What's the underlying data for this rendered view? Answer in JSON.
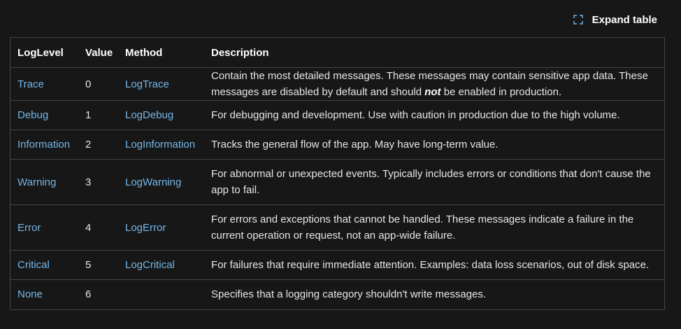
{
  "expand_label": "Expand table",
  "colors": {
    "link": "#75b6e7",
    "border": "#454545",
    "background": "#171717"
  },
  "table": {
    "headers": [
      "LogLevel",
      "Value",
      "Method",
      "Description"
    ],
    "rows": [
      {
        "level": "Trace",
        "value": "0",
        "method": "LogTrace",
        "desc_before": "Contain the most detailed messages. These messages may contain sensitive app data. These messages are disabled by default and should ",
        "desc_em": "not",
        "desc_after": " be enabled in production."
      },
      {
        "level": "Debug",
        "value": "1",
        "method": "LogDebug",
        "desc_before": "For debugging and development. Use with caution in production due to the high volume.",
        "desc_em": "",
        "desc_after": ""
      },
      {
        "level": "Information",
        "value": "2",
        "method": "LogInformation",
        "desc_before": "Tracks the general flow of the app. May have long-term value.",
        "desc_em": "",
        "desc_after": ""
      },
      {
        "level": "Warning",
        "value": "3",
        "method": "LogWarning",
        "desc_before": "For abnormal or unexpected events. Typically includes errors or conditions that don't cause the app to fail.",
        "desc_em": "",
        "desc_after": ""
      },
      {
        "level": "Error",
        "value": "4",
        "method": "LogError",
        "desc_before": "For errors and exceptions that cannot be handled. These messages indicate a failure in the current operation or request, not an app-wide failure.",
        "desc_em": "",
        "desc_after": ""
      },
      {
        "level": "Critical",
        "value": "5",
        "method": "LogCritical",
        "desc_before": "For failures that require immediate attention. Examples: data loss scenarios, out of disk space.",
        "desc_em": "",
        "desc_after": ""
      },
      {
        "level": "None",
        "value": "6",
        "method": "",
        "desc_before": "Specifies that a logging category shouldn't write messages.",
        "desc_em": "",
        "desc_after": ""
      }
    ]
  }
}
